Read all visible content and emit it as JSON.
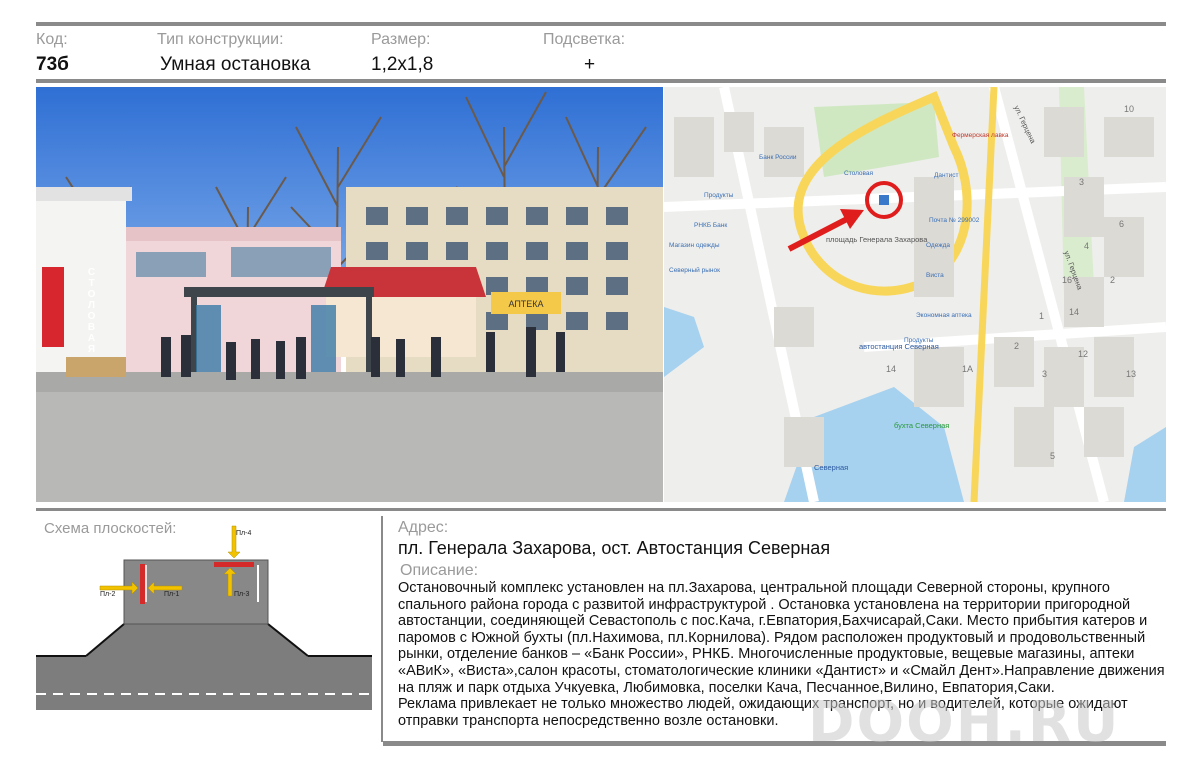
{
  "header": {
    "code_label": "Код:",
    "code_value": "73б",
    "type_label": "Тип конструкции:",
    "type_value": "Умная остановка",
    "size_label": "Размер:",
    "size_value": "1,2х1,8",
    "light_label": "Подсветка:",
    "light_value": "+"
  },
  "photo": {
    "kiosk_sign": "СТОЛОВАЯ",
    "pharmacy_sign": "АПТЕКА"
  },
  "map": {
    "labels": {
      "square": "площадь Генерала Захарова",
      "bus_station": "автостанция Северная",
      "street1": "ул. Герцена",
      "street2": "ул. Герцена",
      "bay": "бухта Северная",
      "pier": "Северная",
      "bank": "Банк России",
      "products": "Продукты",
      "pharmacy": "Экономная аптека",
      "canteen": "Столовая",
      "dentist": "Дантист",
      "rnkb": "РНКБ Банк",
      "post": "Почта № 299002",
      "market": "Северный рынок",
      "clothes": "Одежда",
      "magazin": "Магазин одежды",
      "fermer": "Фермерская лавка",
      "vista": "Виста"
    },
    "numbers": [
      "10",
      "3",
      "6",
      "4",
      "16",
      "2",
      "1",
      "14",
      "12",
      "1А",
      "13",
      "5",
      "2",
      "3",
      "14"
    ]
  },
  "scheme": {
    "title": "Схема плоскостей:",
    "planes": [
      "Пл-1",
      "Пл-2",
      "Пл-3",
      "Пл-4"
    ]
  },
  "address": {
    "label": "Адрес:",
    "value": "пл. Генерала Захарова, ост. Автостанция Северная"
  },
  "description": {
    "label": "Описание:",
    "paragraph1": "Остановочный комплекс установлен на пл.Захарова, центральной площади Северной стороны, крупного спального района города с развитой инфраструктурой . Остановка установлена на территории пригородной автостанции, соединяющей Севастополь с пос.Кача, г.Евпатория,Бахчисарай,Саки. Место прибытия катеров и паромов с Южной бухты (пл.Нахимова, пл.Корнилова). Рядом расположен продуктовый и продовольственный рынки, отделение банков – «Банк России», РНКБ. Многочисленные продуктовые, вещевые магазины, аптеки «АВиК», «Виста»,салон красоты, стоматологические клиники «Дантист» и «Смайл Дент».Направление движения на пляж и парк отдыха Учкуевка, Любимовка, поселки Кача, Песчанное,Вилино, Евпатория,Саки.",
    "paragraph2": "Реклама привлекает не только множество людей, ожидающих транспорт, но и водителей, которые ожидают отправки транспорта непосредственно возле остановки."
  },
  "watermark": "DOOH.RU",
  "colors": {
    "rule": "#8a8a8a",
    "plane_red": "#d42a2a",
    "arrow_yellow": "#f2c200",
    "road": "#7d7d7d"
  }
}
